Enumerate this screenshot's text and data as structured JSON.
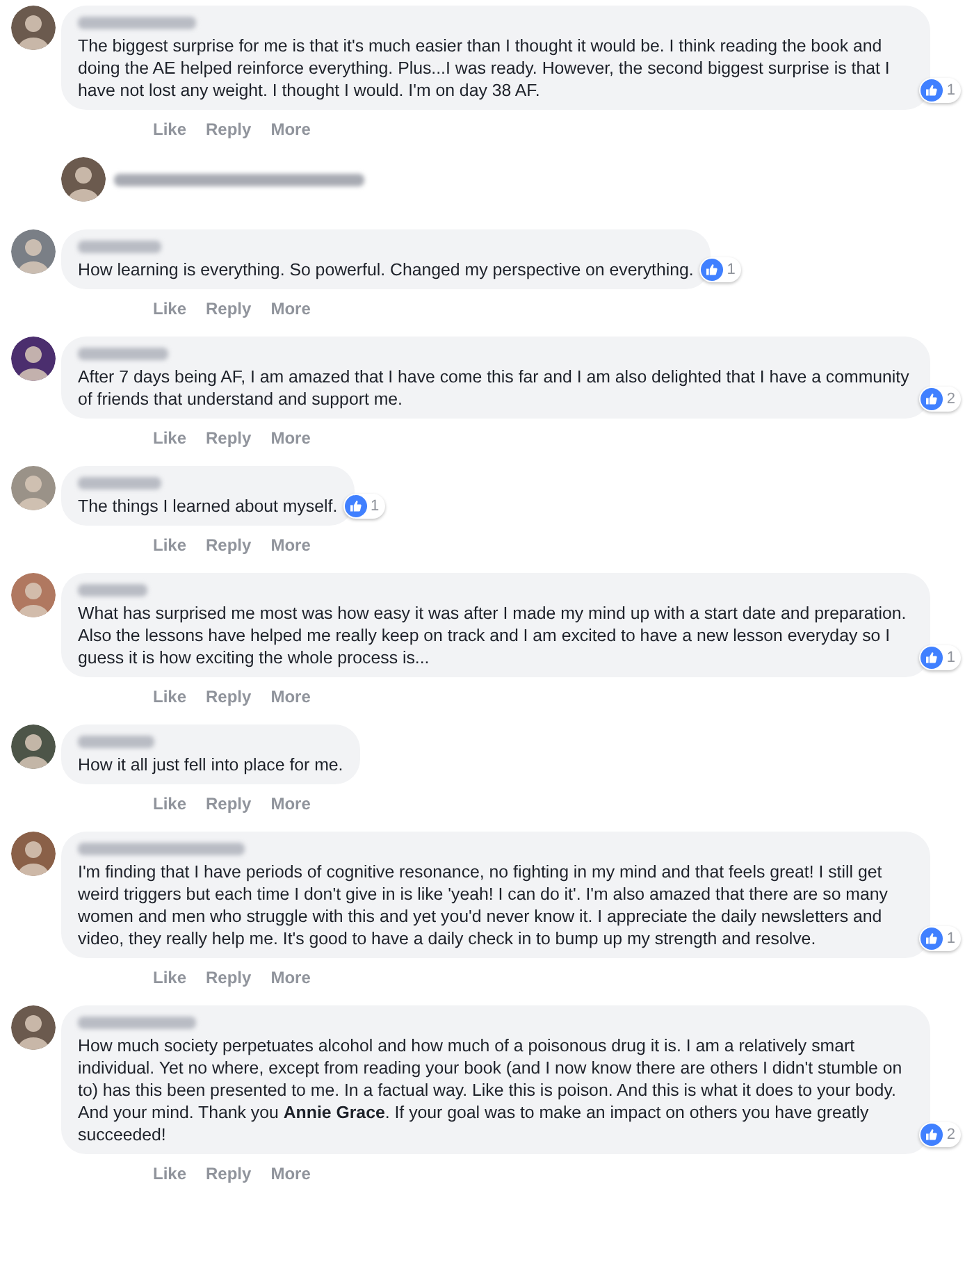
{
  "comments": [
    {
      "kind": "comment",
      "text": "The biggest surprise for me is that it's much easier than I thought it would be. I think reading the book and doing the AE helped reinforce everything. Plus...I was ready. However, the second biggest surprise is that I have not lost any weight. I thought I would. I'm on day 38 AF.",
      "reactions": "1",
      "actions": [
        "Like",
        "Reply",
        "More"
      ]
    },
    {
      "kind": "replies"
    },
    {
      "kind": "comment",
      "text": "How learning is everything. So powerful. Changed my perspective on everything.",
      "reactions": "1",
      "actions": [
        "Like",
        "Reply",
        "More"
      ]
    },
    {
      "kind": "comment",
      "text": "After 7 days being AF, I am amazed that I have come this far and I am also delighted that I have a community of friends that understand and support me.",
      "reactions": "2",
      "actions": [
        "Like",
        "Reply",
        "More"
      ]
    },
    {
      "kind": "comment",
      "text": "The things I learned about myself.",
      "reactions": "1",
      "actions": [
        "Like",
        "Reply",
        "More"
      ]
    },
    {
      "kind": "comment",
      "text": "What has surprised me most was how easy it was after I made my mind up with a start date and preparation. Also the lessons have helped me really keep on track and I am excited to have a new lesson everyday so I guess it is how exciting the whole process is...",
      "reactions": "1",
      "actions": [
        "Like",
        "Reply",
        "More"
      ]
    },
    {
      "kind": "comment",
      "text": "How it all just fell into place for me.",
      "actions": [
        "Like",
        "Reply",
        "More"
      ]
    },
    {
      "kind": "comment",
      "text": "I'm finding that I have periods of cognitive resonance, no fighting in my mind and that feels great! I still get weird triggers but each time I don't give in is like 'yeah! I can do it'. I'm also amazed that there are so many women and men who struggle with this and yet you'd never know it. I appreciate the daily newsletters and video, they really help me. It's good to have a daily check in to bump up my strength and resolve.",
      "reactions": "1",
      "actions": [
        "Like",
        "Reply",
        "More"
      ]
    },
    {
      "kind": "comment",
      "text": "How much society perpetuates alcohol and how much of a poisonous drug it is. I am a relatively smart individual. Yet no where, except from reading your book (and I now know there are others I didn't stumble on to) has this been presented to me. In a factual way. Like this is poison. And this is what it does to your body. And your mind. Thank you **Annie Grace**. If your goal was to make an impact on others you have greatly succeeded!",
      "reactions": "2",
      "actions": [
        "Like",
        "Reply",
        "More"
      ]
    }
  ]
}
